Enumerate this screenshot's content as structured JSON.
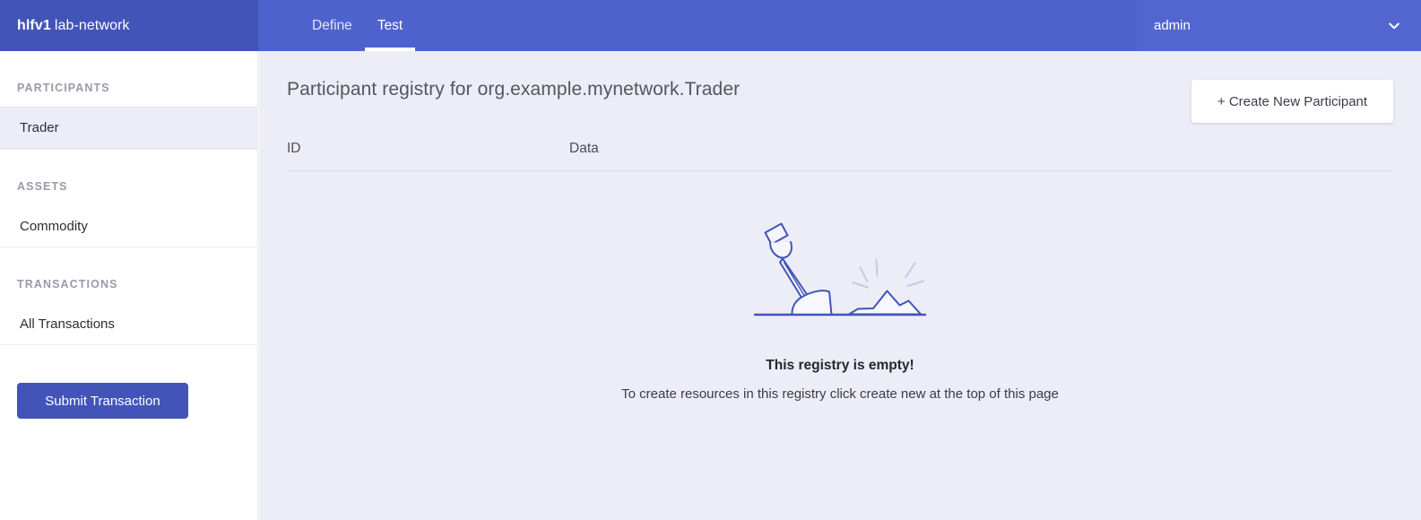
{
  "header": {
    "brand_strong": "hlfv1",
    "brand_rest": "lab-network",
    "tabs": [
      {
        "label": "Define",
        "active": false
      },
      {
        "label": "Test",
        "active": true
      }
    ],
    "user": {
      "name": "admin",
      "chevron_icon": "chevron-down-icon"
    }
  },
  "sidebar": {
    "sections": [
      {
        "heading": "PARTICIPANTS",
        "items": [
          {
            "label": "Trader",
            "selected": true
          }
        ]
      },
      {
        "heading": "ASSETS",
        "items": [
          {
            "label": "Commodity",
            "selected": false
          }
        ]
      },
      {
        "heading": "TRANSACTIONS",
        "items": [
          {
            "label": "All Transactions",
            "selected": false
          }
        ]
      }
    ],
    "submit_label": "Submit Transaction"
  },
  "main": {
    "page_title": "Participant registry for org.example.mynetwork.Trader",
    "create_label": "+ Create New Participant",
    "table": {
      "columns": [
        "ID",
        "Data"
      ],
      "rows": []
    },
    "empty_state": {
      "illustration": "shovel-digging-icon",
      "title": "This registry is empty!",
      "subtitle": "To create resources in this registry click create new at the top of this page"
    }
  },
  "colors": {
    "brand_dark": "#4354b8",
    "header_blue": "#4e62cd",
    "user_blue": "#5366d0",
    "main_bg": "#ecedf6",
    "sidebar_selected": "#eceef7",
    "illustration_stroke": "#4155b5"
  }
}
